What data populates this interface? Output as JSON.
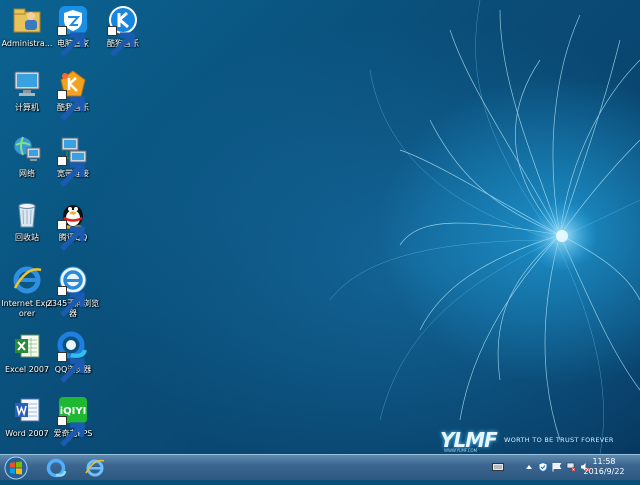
{
  "desktop": {
    "icons": [
      {
        "label": "Administra...",
        "icon": "user-folder-icon",
        "shortcut": false
      },
      {
        "label": "电脑管家",
        "icon": "tencent-pc-manager-icon",
        "shortcut": true
      },
      {
        "label": "酷狗音乐",
        "icon": "kugou-music-icon",
        "shortcut": true
      },
      {
        "label": "计算机",
        "icon": "computer-icon",
        "shortcut": false
      },
      {
        "label": "酷我音乐",
        "icon": "kuwo-music-icon",
        "shortcut": true
      },
      {
        "label": "网络",
        "icon": "network-icon",
        "shortcut": false
      },
      {
        "label": "宽带连接",
        "icon": "broadband-connection-icon",
        "shortcut": true
      },
      {
        "label": "回收站",
        "icon": "recycle-bin-icon",
        "shortcut": false
      },
      {
        "label": "腾讯QQ",
        "icon": "qq-penguin-icon",
        "shortcut": true
      },
      {
        "label": "Internet Explorer",
        "icon": "internet-explorer-icon",
        "shortcut": false
      },
      {
        "label": "2345王牌浏览器",
        "icon": "2345-browser-icon",
        "shortcut": true
      },
      {
        "label": "Excel 2007",
        "icon": "excel-icon",
        "shortcut": false
      },
      {
        "label": "QQ浏览器",
        "icon": "qq-browser-icon",
        "shortcut": true
      },
      {
        "label": "Word 2007",
        "icon": "word-icon",
        "shortcut": false
      },
      {
        "label": "爱奇艺PPS",
        "icon": "iqiyi-icon",
        "shortcut": true
      }
    ],
    "wallpaper_logo": {
      "text": "YLMF",
      "slogan": "WORTH TO BE TRUST FOREVER",
      "url": "WWW.YLMF.COM"
    }
  },
  "taskbar": {
    "start_icon": "windows-start-icon",
    "pinned": [
      {
        "name": "qq-browser-taskbar-icon"
      },
      {
        "name": "internet-explorer-taskbar-icon"
      }
    ],
    "tray": {
      "icons": [
        "keyboard-icon",
        "show-hidden-icons-chevron",
        "shield-icon",
        "flag-icon",
        "network-disconnected-icon",
        "volume-muted-icon"
      ],
      "time": "11:58",
      "date": "2016/9/22"
    }
  },
  "colors": {
    "wallpaper": "#0a4f78",
    "taskbar": "#3c6690",
    "glow": "#5cc8ff"
  }
}
